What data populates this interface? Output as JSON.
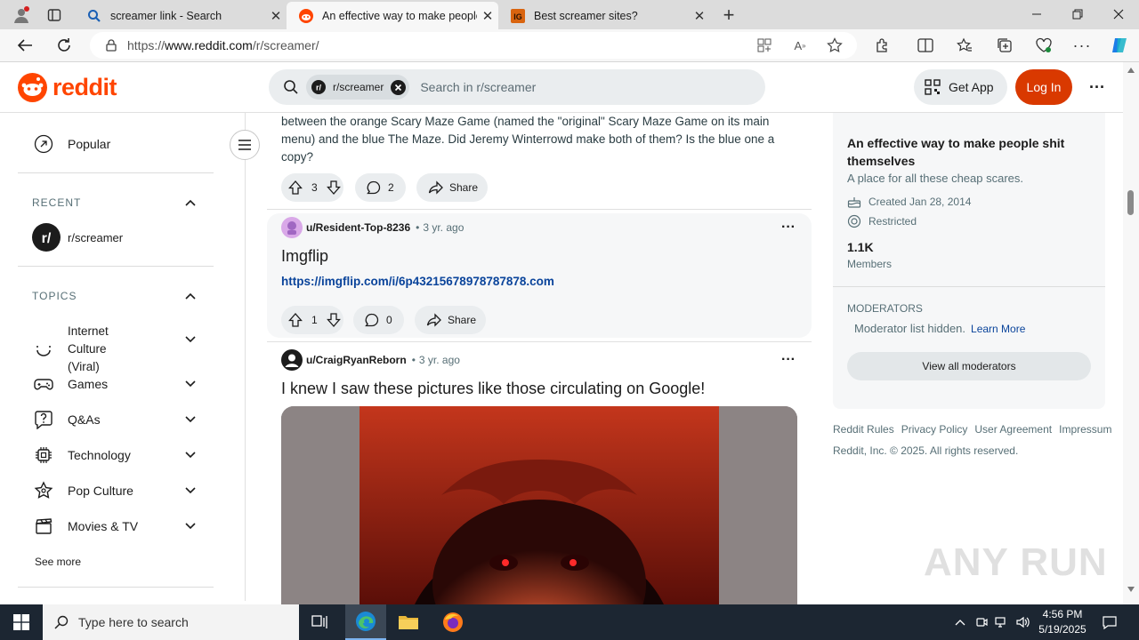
{
  "browser": {
    "tabs": [
      {
        "title": "screamer link - Search",
        "icon": "bing-search-icon"
      },
      {
        "title": "An effective way to make people",
        "icon": "reddit-icon"
      },
      {
        "title": "Best screamer sites?",
        "icon": "ig-icon"
      }
    ],
    "url_prefix": "https://",
    "url_host": "www.reddit.com",
    "url_path": "/r/screamer/"
  },
  "reddit": {
    "logo_text": "reddit",
    "search_chip": "r/screamer",
    "search_placeholder": "Search in r/screamer",
    "get_app": "Get App",
    "log_in": "Log In"
  },
  "sidebar": {
    "popular": "Popular",
    "recent_header": "RECENT",
    "recent_item": "r/screamer",
    "topics_header": "TOPICS",
    "topics": [
      {
        "label": "Internet Culture (Viral)",
        "icon": "smile-icon"
      },
      {
        "label": "Games",
        "icon": "gamepad-icon"
      },
      {
        "label": "Q&As",
        "icon": "question-icon"
      },
      {
        "label": "Technology",
        "icon": "chip-icon"
      },
      {
        "label": "Pop Culture",
        "icon": "star-icon"
      },
      {
        "label": "Movies & TV",
        "icon": "clapper-icon"
      }
    ],
    "see_more": "See more"
  },
  "feed": {
    "post0": {
      "body": "between the orange Scary Maze Game (named the \"original\" Scary Maze Game on its main menu) and the blue The Maze. Did Jeremy Winterrowd make both of them? Is the blue one a copy?",
      "votes": "3",
      "comments": "2",
      "share": "Share"
    },
    "post1": {
      "author": "u/Resident-Top-8236",
      "age": "3 yr. ago",
      "title": "Imgflip",
      "link": "https://imgflip.com/i/6p43215678978787878.com",
      "votes": "1",
      "comments": "0",
      "share": "Share"
    },
    "post2": {
      "author": "u/CraigRyanReborn",
      "age": "3 yr. ago",
      "title": "I knew I saw these pictures like those circulating on Google!"
    },
    "dot": "•"
  },
  "about": {
    "title": "An effective way to make people shit themselves",
    "description": "A place for all these cheap scares.",
    "created": "Created Jan 28, 2014",
    "restricted": "Restricted",
    "members_count": "1.1K",
    "members_label": "Members",
    "moderators_header": "MODERATORS",
    "mod_hidden": "Moderator list hidden.",
    "learn_more": "Learn More",
    "view_mods": "View all moderators"
  },
  "footer": {
    "links": [
      "Reddit Rules",
      "Privacy Policy",
      "User Agreement",
      "Impressum"
    ],
    "copyright": "Reddit, Inc. © 2025. All rights reserved."
  },
  "taskbar": {
    "search_placeholder": "Type here to search",
    "time": "4:56 PM",
    "date": "5/19/2025"
  },
  "watermark": "ANY RUN",
  "colors": {
    "reddit_orange": "#ff4500",
    "login_btn": "#d93900",
    "link_blue": "#0a449b",
    "taskbar": "#1c2632"
  }
}
